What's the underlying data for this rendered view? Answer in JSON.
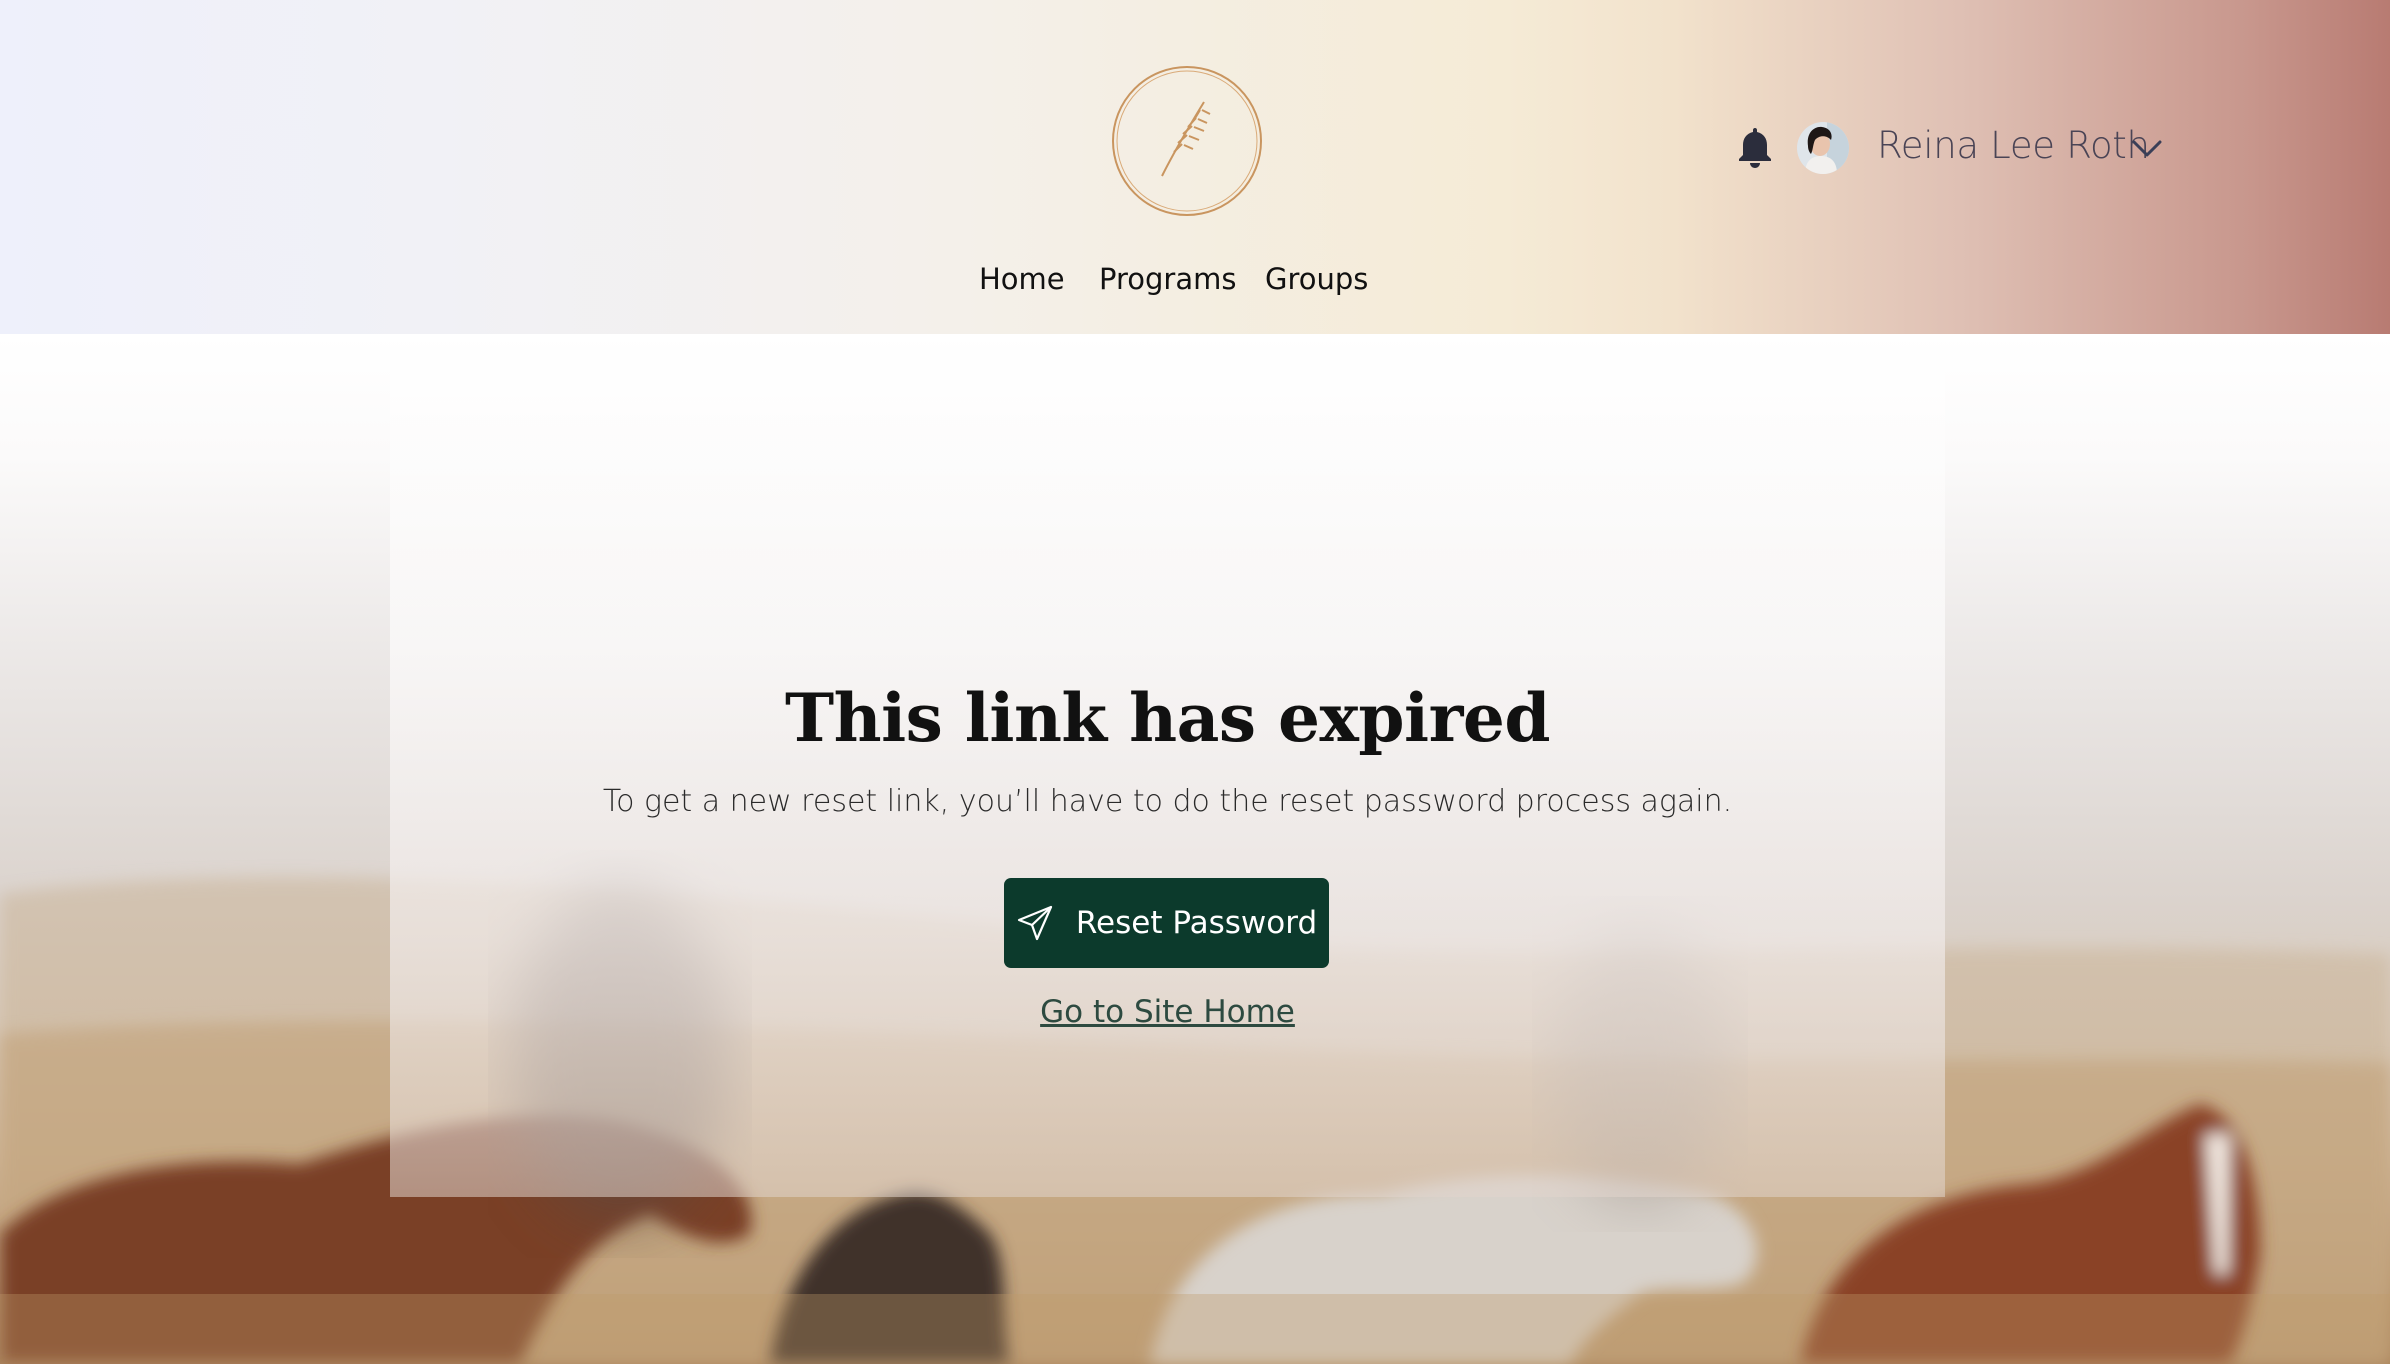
{
  "header": {
    "nav": [
      {
        "label": "Home"
      },
      {
        "label": "Programs"
      },
      {
        "label": "Groups"
      }
    ],
    "user": {
      "name": "Reina Lee Roth",
      "icons": [
        "bell-icon",
        "avatar",
        "chevron-down-icon"
      ]
    },
    "logo_icon": "wheat-sprig-logo"
  },
  "main": {
    "title": "This link has expired",
    "subtitle": "To get a new reset link, you’ll have to do the reset password process again.",
    "reset_button": {
      "label": "Reset Password",
      "icon": "send-icon"
    },
    "home_link": "Go to Site Home"
  },
  "colors": {
    "button_bg": "#0c3a2c",
    "link": "#2d4a40",
    "logo": "#c9955f",
    "bell": "#2b2d3c"
  }
}
